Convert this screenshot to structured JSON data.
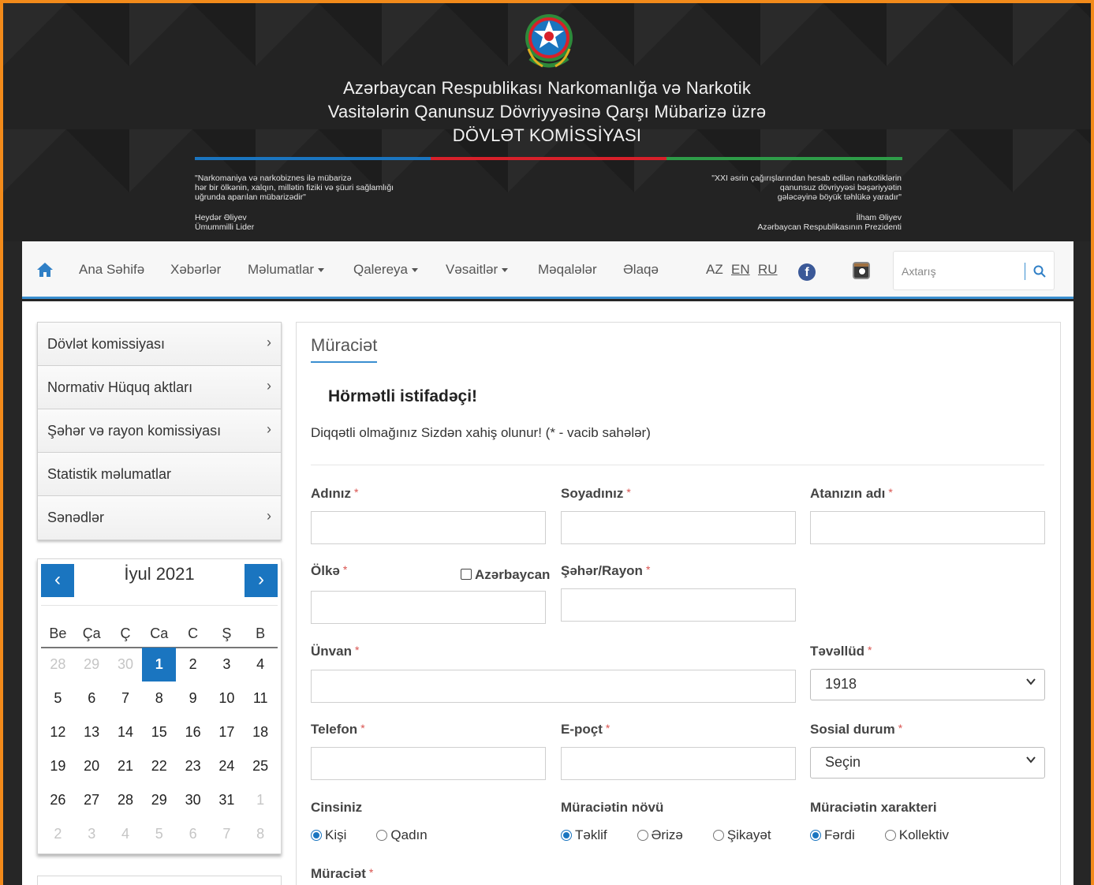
{
  "header": {
    "title_line1": "Azərbaycan Respublikası Narkomanlığa və Narkotik",
    "title_line2": "Vasitələrin Qanunsuz Dövriyyəsinə Qarşı Mübarizə üzrə",
    "title_line3": "DÖVLƏT KOMİSSİYASI",
    "quote_left": {
      "line1": "\"Narkomaniya və narkobiznes ilə mübarizə",
      "line2": "hər bir ölkənin, xalqın, millətin fiziki və şüuri sağlamlığı",
      "line3": "uğrunda aparılan mübarizədir\"",
      "author": "Heydər Əliyev",
      "role": "Ümummilli Lider"
    },
    "quote_right": {
      "line1": "\"XXI əsrin çağırışlarından hesab edilən narkotiklərin",
      "line2": "qanunsuz dövriyyəsi bəşəriyyətin",
      "line3": "gələcəyinə böyük təhlükə yaradır\"",
      "author": "İlham Əliyev",
      "role": "Azərbaycan Respublikasının Prezidenti"
    },
    "flag_colors": [
      "#1a75c0",
      "#d8202a",
      "#2e9c48"
    ]
  },
  "nav": {
    "home_icon": "home-icon",
    "items": [
      "Ana Səhifə",
      "Xəbərlər",
      "Məlumatlar",
      "Qalereya",
      "Vəsaitlər",
      "Məqalələr",
      "Əlaqə"
    ],
    "languages": [
      "AZ",
      "EN",
      "RU"
    ],
    "search_placeholder": "Axtarış"
  },
  "sidebar": {
    "items": [
      "Dövlət komissiyası",
      "Normativ Hüquq aktları",
      "Şəhər və rayon komissiyası",
      "Statistik məlumatlar",
      "Sənədlər"
    ]
  },
  "calendar": {
    "title": "İyul 2021",
    "weekdays": [
      "Be",
      "Ça",
      "Ç",
      "Ca",
      "C",
      "Ş",
      "B"
    ],
    "weeks": [
      [
        "28",
        "29",
        "30",
        "1",
        "2",
        "3",
        "4"
      ],
      [
        "5",
        "6",
        "7",
        "8",
        "9",
        "10",
        "11"
      ],
      [
        "12",
        "13",
        "14",
        "15",
        "16",
        "17",
        "18"
      ],
      [
        "19",
        "20",
        "21",
        "22",
        "23",
        "24",
        "25"
      ],
      [
        "26",
        "27",
        "28",
        "29",
        "30",
        "31",
        "1"
      ],
      [
        "2",
        "3",
        "4",
        "5",
        "6",
        "7",
        "8"
      ]
    ]
  },
  "form": {
    "panel_title": "Müraciət",
    "greeting": "Hörmətli istifadəçi!",
    "note": "Diqqətli olmağınız Sizdən xahiş olunur! (* - vacib sahələr)",
    "required_mark": "*",
    "labels": {
      "first_name": "Adınız",
      "last_name": "Soyadınız",
      "father_name": "Atanızın adı",
      "country": "Ölkə",
      "azerbaijan_checkbox": "Azərbaycan",
      "city": "Şəhər/Rayon",
      "address": "Ünvan",
      "birth_year": "Təvəllüd",
      "phone": "Telefon",
      "email": "E-poçt",
      "social_status": "Sosial durum",
      "gender": "Cinsiniz",
      "appeal_type": "Müraciətin növü",
      "appeal_character": "Müraciətin xarakteri",
      "appeal": "Müraciət"
    },
    "birth_year_value": "1918",
    "social_status_value": "Seçin",
    "gender_options": [
      "Kişi",
      "Qadın"
    ],
    "appeal_type_options": [
      "Təklif",
      "Ərizə",
      "Şikayət"
    ],
    "appeal_character_options": [
      "Fərdi",
      "Kollektiv"
    ]
  }
}
